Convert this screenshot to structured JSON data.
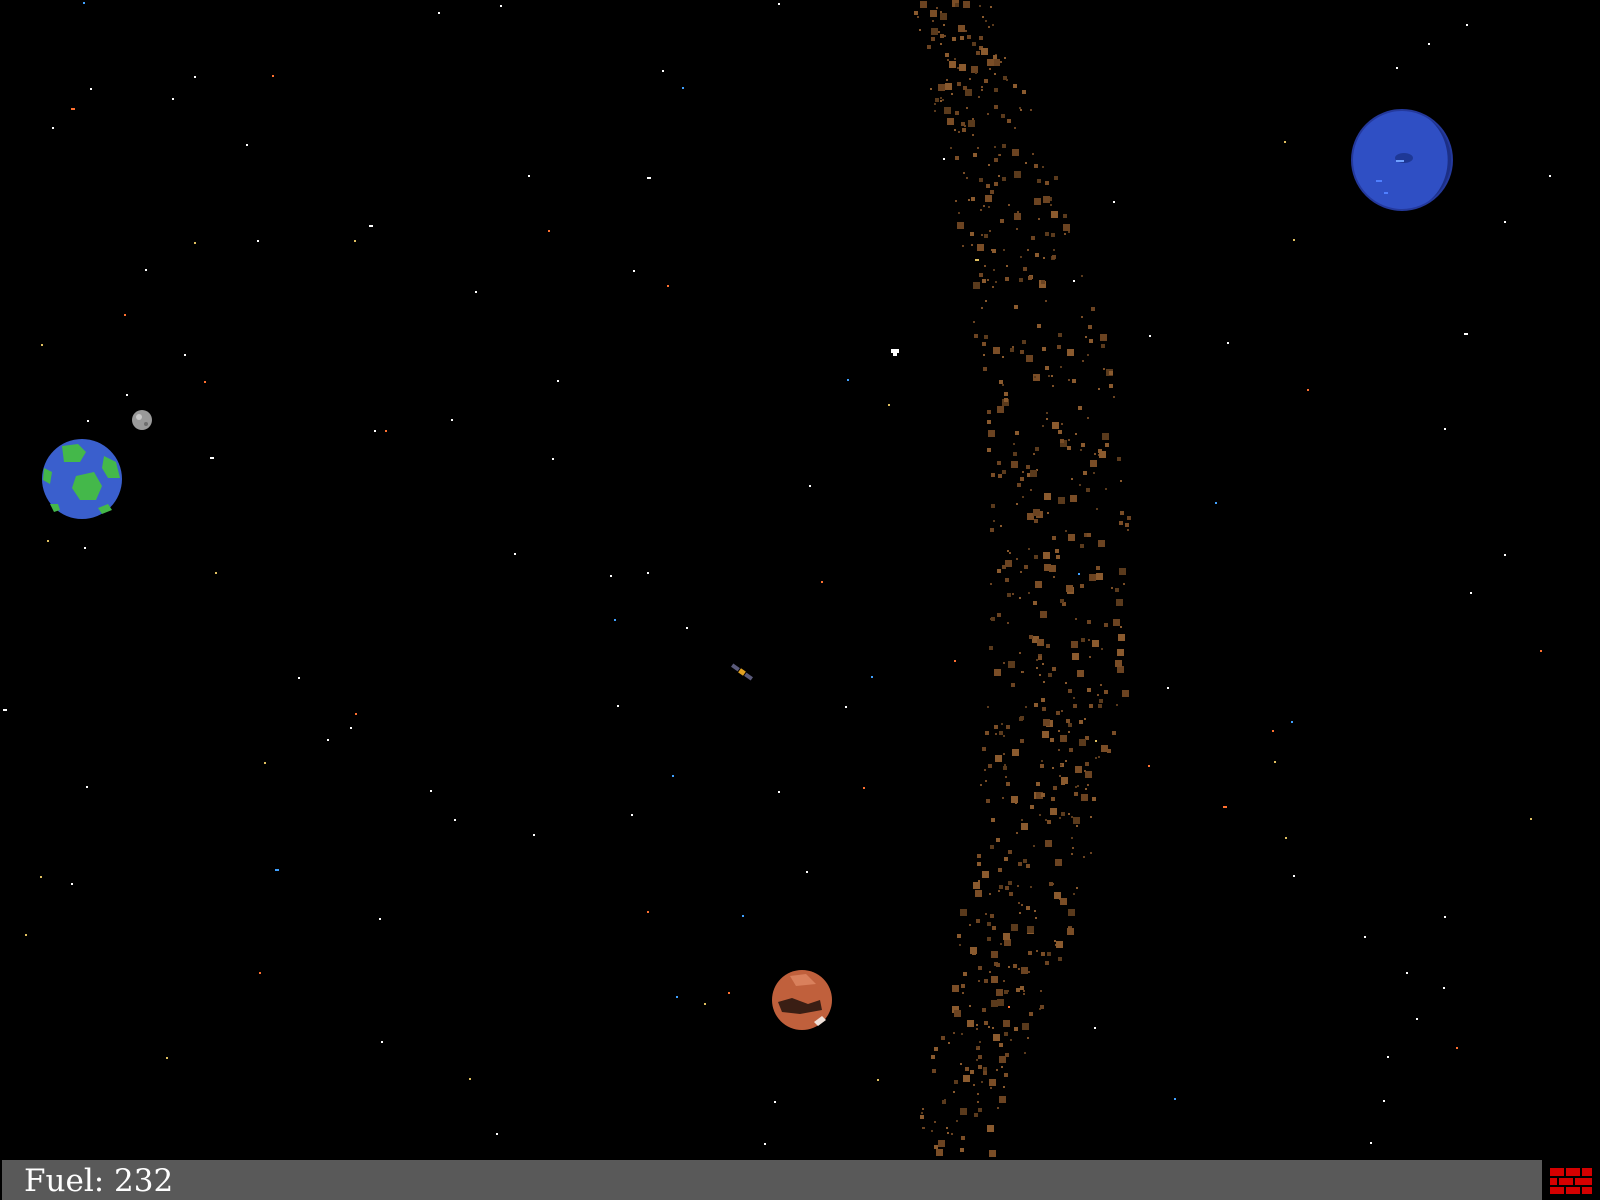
{
  "hud": {
    "fuel_label": "Fuel:",
    "fuel_value": "232",
    "bar_color": "#595959",
    "indicator_icon": "red-brick-icon",
    "indicator_color": "#d40000"
  },
  "scene": {
    "background_color": "#000000",
    "planets": [
      {
        "name": "earth",
        "color": "#3a5fcd",
        "land_color": "#44b84a"
      },
      {
        "name": "moon",
        "color": "#9a9a9a"
      },
      {
        "name": "mars",
        "color": "#c0603c"
      },
      {
        "name": "neptune",
        "color": "#2f4fc4"
      }
    ],
    "asteroid_belt_color": "#6b4321",
    "ship": {
      "name": "satellite-ship"
    }
  }
}
